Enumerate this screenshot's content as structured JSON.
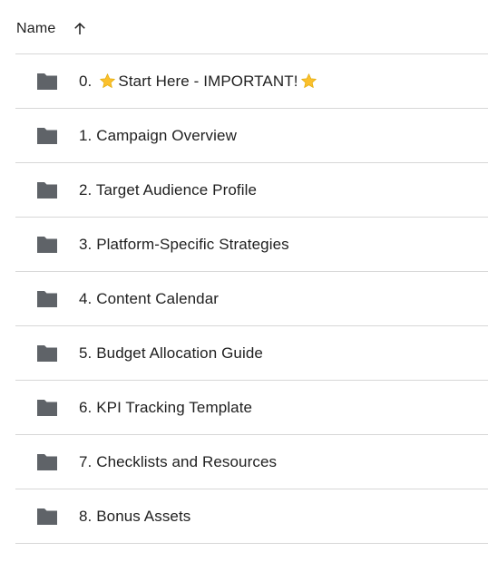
{
  "header": {
    "name_label": "Name",
    "sort_icon": "arrow-up-icon"
  },
  "files": [
    {
      "prefix": "0.",
      "label": "Start Here - IMPORTANT!",
      "icon": "folder-icon",
      "starred": true
    },
    {
      "label": "1. Campaign Overview",
      "icon": "folder-icon"
    },
    {
      "label": "2. Target Audience Profile",
      "icon": "folder-icon"
    },
    {
      "label": "3. Platform-Specific Strategies",
      "icon": "folder-icon"
    },
    {
      "label": "4. Content Calendar",
      "icon": "folder-icon"
    },
    {
      "label": "5. Budget Allocation Guide",
      "icon": "folder-icon"
    },
    {
      "label": "6. KPI Tracking Template",
      "icon": "folder-icon"
    },
    {
      "label": "7. Checklists and Resources",
      "icon": "folder-icon"
    },
    {
      "label": "8. Bonus Assets",
      "icon": "folder-icon"
    }
  ],
  "colors": {
    "folder": "#5f6368",
    "star": "#fbc02d",
    "divider": "#d7d7d7",
    "text": "#1f1f1f"
  }
}
